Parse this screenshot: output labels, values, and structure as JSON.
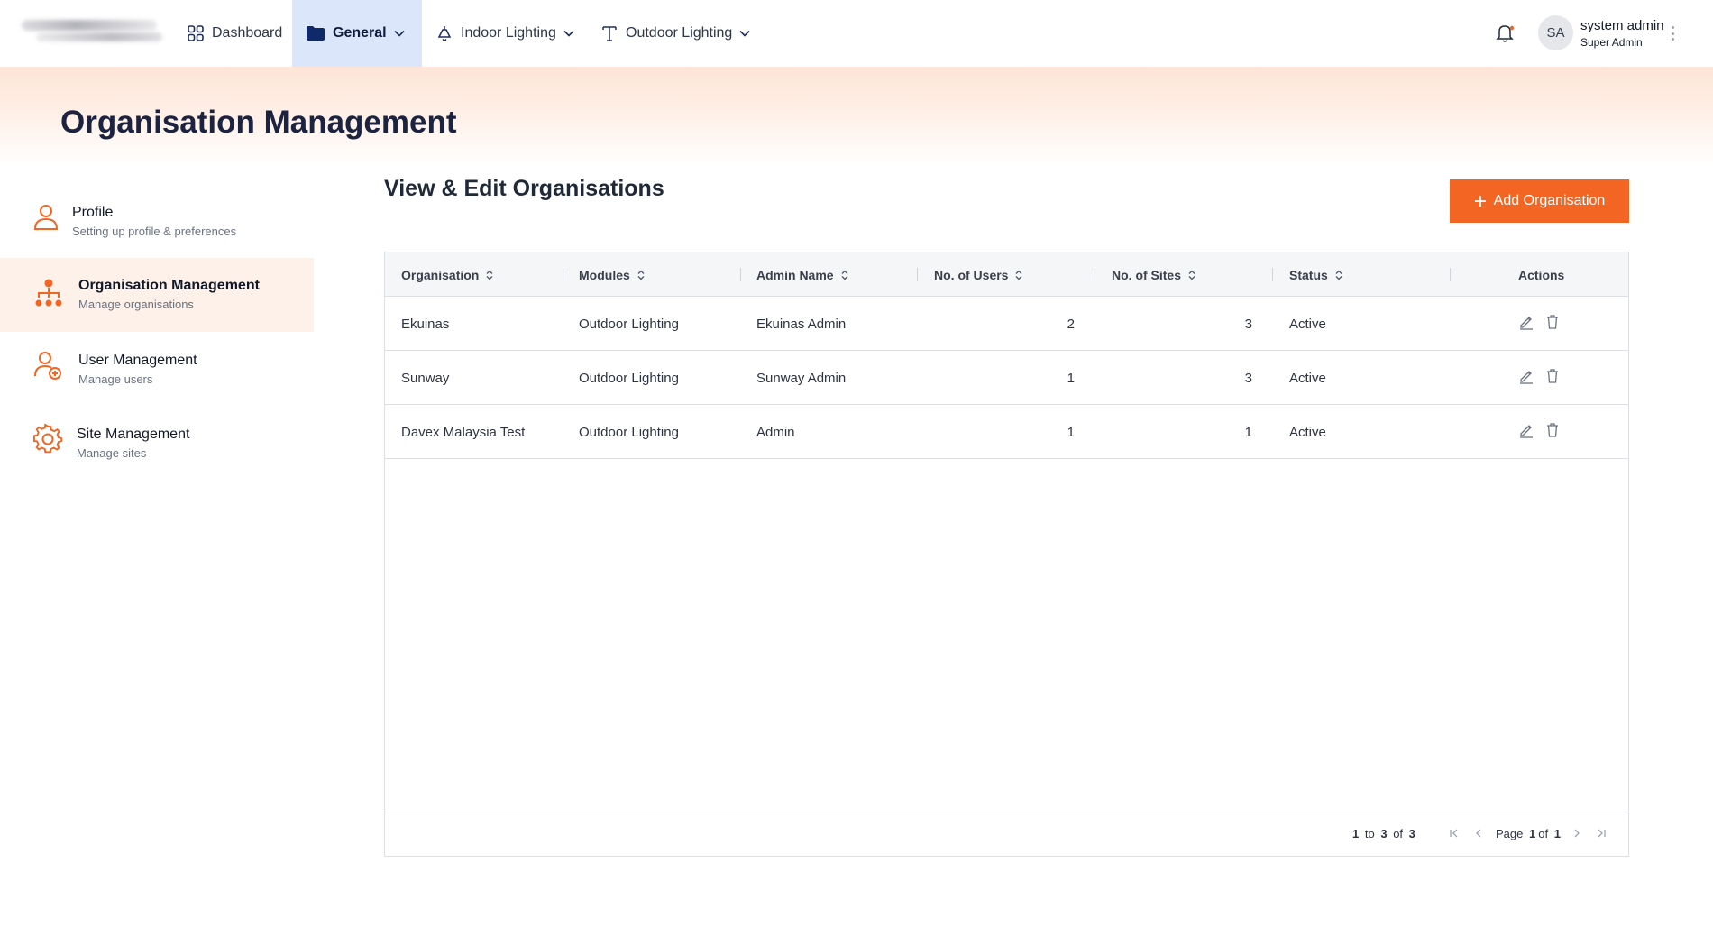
{
  "nav": {
    "dashboard": "Dashboard",
    "general": "General",
    "indoor": "Indoor Lighting",
    "outdoor": "Outdoor Lighting"
  },
  "user": {
    "initials": "SA",
    "name": "system admin",
    "role": "Super Admin"
  },
  "page_title": "Organisation Management",
  "sidebar": {
    "items": [
      {
        "label": "Profile",
        "desc": "Setting up profile & preferences"
      },
      {
        "label": "Organisation Management",
        "desc": "Manage organisations"
      },
      {
        "label": "User Management",
        "desc": "Manage users"
      },
      {
        "label": "Site Management",
        "desc": "Manage sites"
      }
    ]
  },
  "main": {
    "title": "View & Edit Organisations",
    "add_button": "Add Organisation"
  },
  "table": {
    "columns": [
      "Organisation",
      "Modules",
      "Admin Name",
      "No. of Users",
      "No. of Sites",
      "Status",
      "Actions"
    ],
    "rows": [
      [
        "Ekuinas",
        "Outdoor Lighting",
        "Ekuinas Admin",
        "2",
        "3",
        "Active"
      ],
      [
        "Sunway",
        "Outdoor Lighting",
        "Sunway Admin",
        "1",
        "3",
        "Active"
      ],
      [
        "Davex Malaysia Test",
        "Outdoor Lighting",
        "Admin",
        "1",
        "1",
        "Active"
      ]
    ]
  },
  "pagination": {
    "from": "1",
    "to_word": "to",
    "to": "3",
    "of_word": "of",
    "total": "3",
    "page_word": "Page",
    "page": "1",
    "pages": "1"
  },
  "colors": {
    "accent": "#f26522",
    "nav_active_bg": "#dbe6fb",
    "title": "#1b2340"
  },
  "icons": [
    "dashboard-icon",
    "folder-icon",
    "lamp-icon",
    "street-light-icon",
    "chevron-down-icon",
    "bell-icon",
    "user-icon",
    "org-chart-icon",
    "user-add-icon",
    "gear-icon",
    "plus-icon",
    "sort-icon",
    "edit-icon",
    "trash-icon",
    "first-page-icon",
    "prev-page-icon",
    "next-page-icon",
    "last-page-icon"
  ]
}
